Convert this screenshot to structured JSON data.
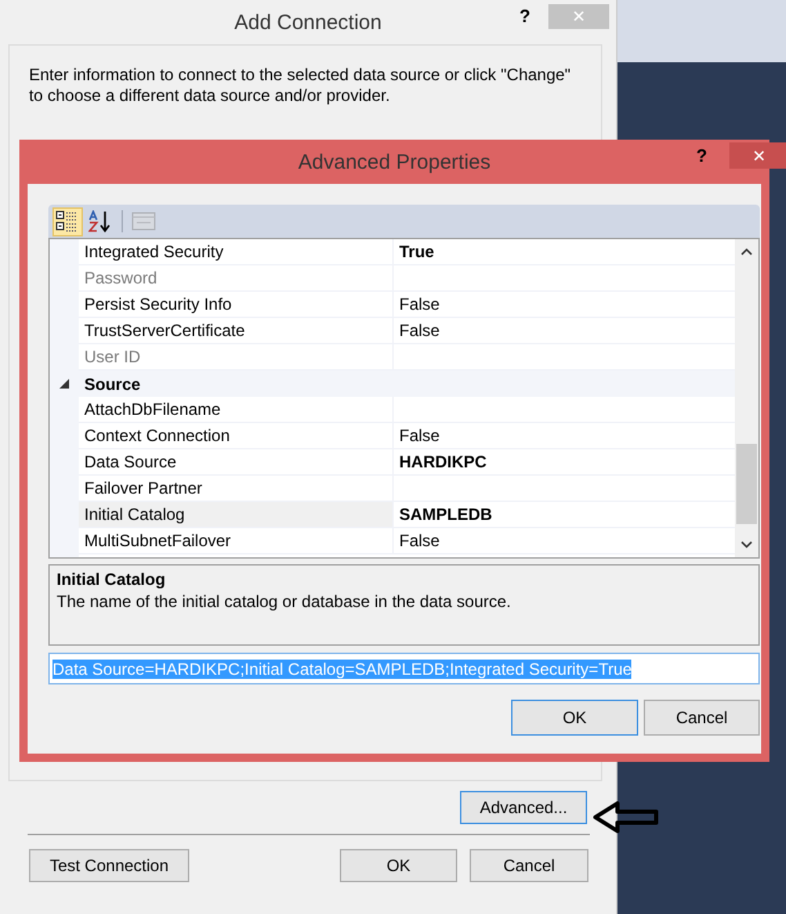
{
  "add_connection": {
    "title": "Add Connection",
    "help": "?",
    "close": "✕",
    "instructions": "Enter information to connect to the selected data source or click \"Change\" to choose a different data source and/or provider.",
    "advanced_button": {
      "label": "Advanced...",
      "focused": true
    },
    "buttons": [
      {
        "kind": "test",
        "label": "Test Connection",
        "focused": false
      },
      {
        "kind": "ok",
        "label": "OK",
        "focused": false
      },
      {
        "kind": "cancel",
        "label": "Cancel",
        "focused": false
      }
    ]
  },
  "advanced_properties": {
    "title": "Advanced Properties",
    "help": "?",
    "close": "✕",
    "toolbar": [
      {
        "kind": "categorized",
        "selected": true,
        "disabled": false
      },
      {
        "kind": "alphabetical",
        "selected": false,
        "disabled": false
      },
      {
        "kind": "property_pages",
        "selected": false,
        "disabled": true
      }
    ],
    "grid": [
      {
        "kind": "property",
        "name": "Integrated Security",
        "value": "True",
        "modified": true,
        "disabled": false,
        "selected": false
      },
      {
        "kind": "property",
        "name": "Password",
        "disabled": true,
        "selected": false
      },
      {
        "kind": "property",
        "name": "Persist Security Info",
        "value": "False",
        "modified": false,
        "disabled": false,
        "selected": false
      },
      {
        "kind": "property",
        "name": "TrustServerCertificate",
        "value": "False",
        "modified": false,
        "disabled": false,
        "selected": false
      },
      {
        "kind": "property",
        "name": "User ID",
        "disabled": true,
        "selected": false
      },
      {
        "kind": "category",
        "name": "Source",
        "expanded": true,
        "children": [
          {
            "kind": "property",
            "name": "AttachDbFilename",
            "disabled": false,
            "selected": false
          },
          {
            "kind": "property",
            "name": "Context Connection",
            "value": "False",
            "modified": false,
            "disabled": false,
            "selected": false
          },
          {
            "kind": "property",
            "name": "Data Source",
            "value": "HARDIKPC",
            "modified": true,
            "disabled": false,
            "selected": false
          },
          {
            "kind": "property",
            "name": "Failover Partner",
            "disabled": false,
            "selected": false
          },
          {
            "kind": "property",
            "name": "Initial Catalog",
            "value": "SAMPLEDB",
            "modified": true,
            "disabled": false,
            "selected": true
          },
          {
            "kind": "property",
            "name": "MultiSubnetFailover",
            "value": "False",
            "modified": false,
            "disabled": false,
            "selected": false
          }
        ]
      }
    ],
    "description": {
      "title": "Initial Catalog",
      "text": "The name of the initial catalog or database in the data source."
    },
    "connection_string": {
      "value": "Data Source=HARDIKPC;Initial Catalog=SAMPLEDB;Integrated Security=True",
      "text_selected": true
    },
    "buttons": [
      {
        "kind": "ok",
        "label": "OK",
        "focused": true
      },
      {
        "kind": "cancel",
        "label": "Cancel",
        "focused": false
      }
    ]
  }
}
